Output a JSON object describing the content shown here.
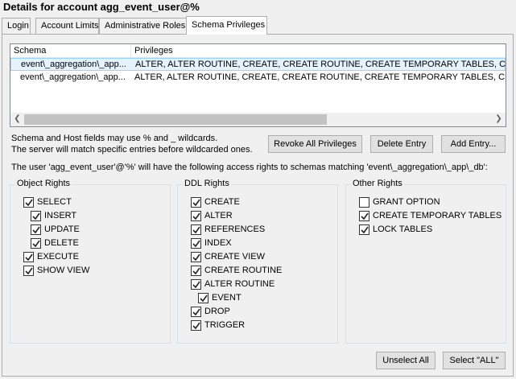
{
  "title": "Details for account agg_event_user@%",
  "tabs": [
    "Login",
    "Account Limits",
    "Administrative Roles",
    "Schema Privileges"
  ],
  "active_tab": "Schema Privileges",
  "list": {
    "columns": [
      "Schema",
      "Privileges"
    ],
    "rows": [
      {
        "schema": "event\\_aggregation\\_app...",
        "privileges": "ALTER, ALTER ROUTINE, CREATE, CREATE ROUTINE, CREATE TEMPORARY TABLES, CREATE",
        "selected": true
      },
      {
        "schema": "event\\_aggregation\\_app...",
        "privileges": "ALTER, ALTER ROUTINE, CREATE, CREATE ROUTINE, CREATE TEMPORARY TABLES, CREATE",
        "selected": false
      }
    ]
  },
  "info": {
    "line1": "Schema and Host fields may use % and _ wildcards.",
    "line2": "The server will match specific entries before wildcarded ones.",
    "access": "The user 'agg_event_user'@'%' will have the following access rights to schemas matching 'event\\_aggregation\\_app\\_db':"
  },
  "buttons": {
    "revoke": "Revoke All Privileges",
    "delete": "Delete Entry",
    "add": "Add Entry...",
    "unselect": "Unselect All",
    "select_all": "Select \"ALL\""
  },
  "groups": {
    "object": {
      "title": "Object Rights",
      "items": [
        {
          "label": "SELECT",
          "checked": true
        },
        {
          "label": "INSERT",
          "checked": true
        },
        {
          "label": "UPDATE",
          "checked": true
        },
        {
          "label": "DELETE",
          "checked": true
        },
        {
          "label": "EXECUTE",
          "checked": true
        },
        {
          "label": "SHOW VIEW",
          "checked": true
        }
      ]
    },
    "ddl": {
      "title": "DDL Rights",
      "items": [
        {
          "label": "CREATE",
          "checked": true
        },
        {
          "label": "ALTER",
          "checked": true
        },
        {
          "label": "REFERENCES",
          "checked": true
        },
        {
          "label": "INDEX",
          "checked": true
        },
        {
          "label": "CREATE VIEW",
          "checked": true
        },
        {
          "label": "CREATE ROUTINE",
          "checked": true
        },
        {
          "label": "ALTER ROUTINE",
          "checked": true
        },
        {
          "label": "EVENT",
          "checked": true
        },
        {
          "label": "DROP",
          "checked": true
        },
        {
          "label": "TRIGGER",
          "checked": true
        }
      ]
    },
    "other": {
      "title": "Other Rights",
      "items": [
        {
          "label": "GRANT OPTION",
          "checked": false
        },
        {
          "label": "CREATE TEMPORARY TABLES",
          "checked": true
        },
        {
          "label": "LOCK TABLES",
          "checked": true
        }
      ]
    }
  }
}
